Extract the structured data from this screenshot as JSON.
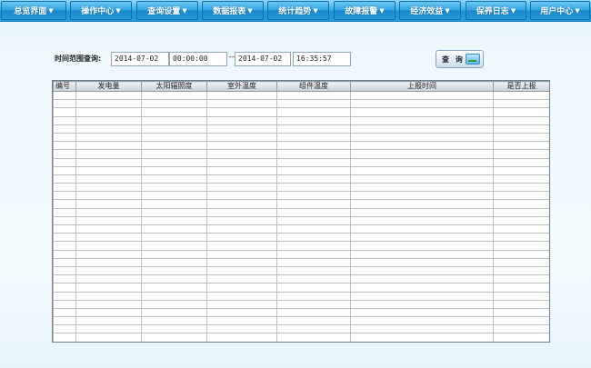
{
  "nav": {
    "items": [
      {
        "label": "总览界面"
      },
      {
        "label": "操作中心"
      },
      {
        "label": "查询设置"
      },
      {
        "label": "数据报表"
      },
      {
        "label": "统计趋势"
      },
      {
        "label": "故障报警"
      },
      {
        "label": "经济效益"
      },
      {
        "label": "保养日志"
      },
      {
        "label": "用户中心"
      }
    ]
  },
  "filter": {
    "label": "时间范围查询:",
    "start_date": "2014-07-02",
    "start_time": "00:00:00",
    "separator": "—",
    "end_date": "2014-07-02",
    "end_time": "16:35:57",
    "query_label": "查 询"
  },
  "table": {
    "headers": [
      "编号",
      "发电量",
      "太阳辐照度",
      "室外温度",
      "组件温度",
      "上报时间",
      "是否上报"
    ]
  }
}
